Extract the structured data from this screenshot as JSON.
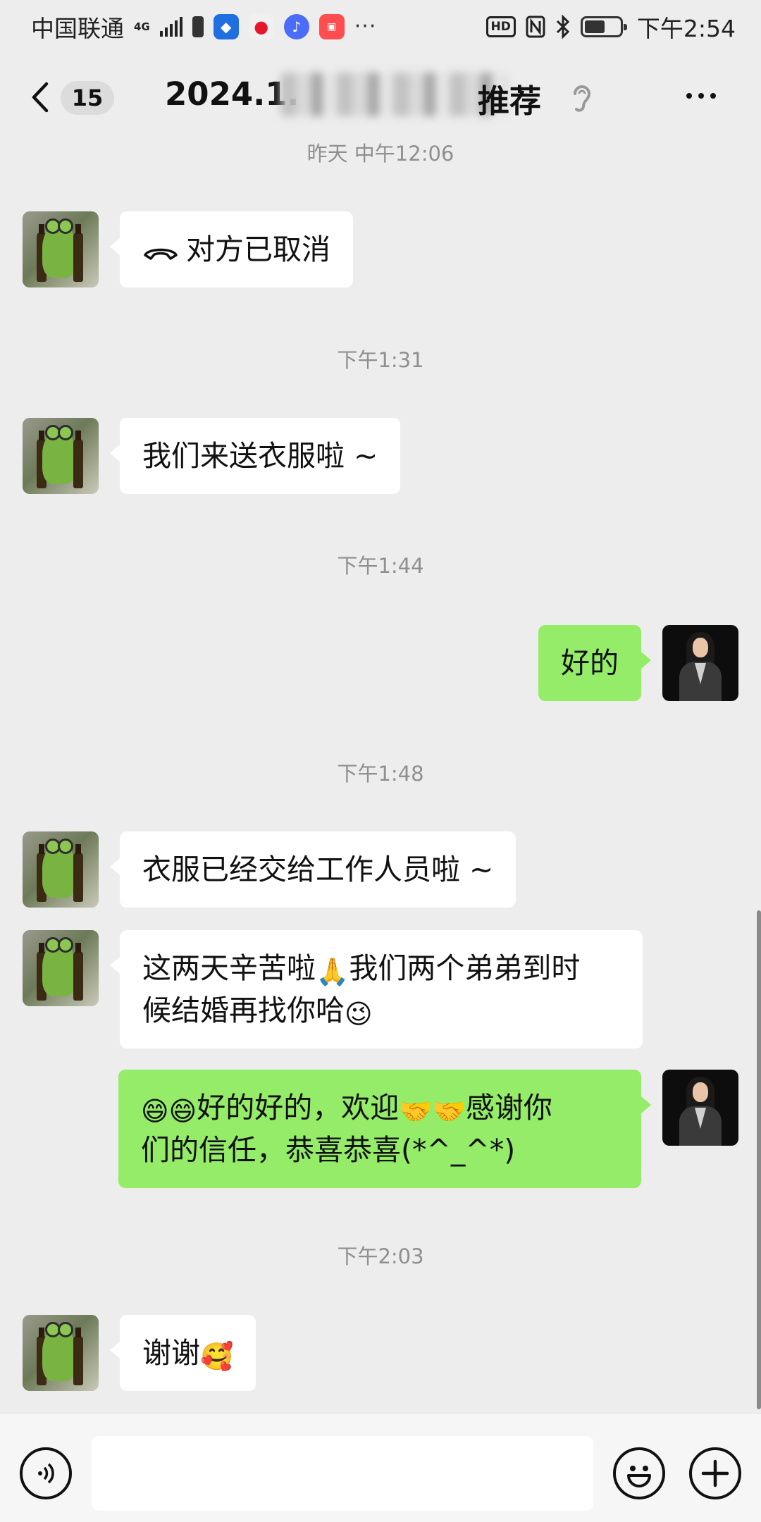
{
  "status_bar": {
    "carrier": "中国联通",
    "network": "4G",
    "time": "下午2:54",
    "hd_label": "HD"
  },
  "nav": {
    "unread_count": "15",
    "title_visible_start": "2024.1.",
    "title_visible_end": "推荐"
  },
  "messages": {
    "ts1": "昨天 中午12:06",
    "m1": "对方已取消",
    "ts2": "下午1:31",
    "m2": "我们来送衣服啦 ~",
    "ts3": "下午1:44",
    "m3": "好的",
    "ts4": "下午1:48",
    "m4": "衣服已经交给工作人员啦 ~",
    "m5_line1": "这两天辛苦啦",
    "m5_line1_emoji": "🙏",
    "m5_line1_b": "我们两个弟弟到时",
    "m5_line2": "候结婚再找你哈",
    "m5_line2_emoji": "😉",
    "m6_emoji_a": "😄😄",
    "m6_line1_a": "好的好的，欢迎",
    "m6_emoji_b": "🤝🤝",
    "m6_line1_b": "感谢你",
    "m6_line2": "们的信任，恭喜恭喜(*^_^*)",
    "ts5": "下午2:03",
    "m7": "谢谢",
    "m7_emoji": "🥰"
  },
  "colors": {
    "background": "#ededed",
    "incoming_bubble": "#ffffff",
    "outgoing_bubble": "#95ec69",
    "timestamp": "#8f8f8f"
  },
  "icons": [
    "back-arrow-icon",
    "ear-icon",
    "more-icon",
    "hang-up-icon",
    "voice-icon",
    "emoji-icon",
    "plus-icon"
  ]
}
